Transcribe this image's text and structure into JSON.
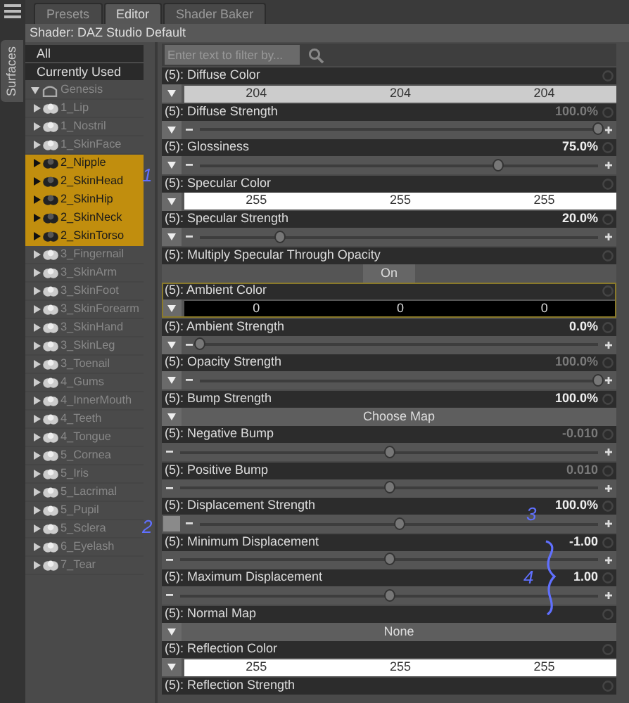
{
  "side_tab": {
    "label": "Surfaces"
  },
  "tabs": [
    {
      "label": "Presets",
      "selected": false
    },
    {
      "label": "Editor",
      "selected": true
    },
    {
      "label": "Shader Baker",
      "selected": false
    }
  ],
  "shader": "Shader: DAZ Studio Default",
  "filters": [
    {
      "label": "All"
    },
    {
      "label": "Currently Used"
    }
  ],
  "tree": {
    "label": "Genesis",
    "expanded": true,
    "children": [
      {
        "label": "1_Lip",
        "selected": false
      },
      {
        "label": "1_Nostril",
        "selected": false
      },
      {
        "label": "1_SkinFace",
        "selected": false
      },
      {
        "label": "2_Nipple",
        "selected": true
      },
      {
        "label": "2_SkinHead",
        "selected": true
      },
      {
        "label": "2_SkinHip",
        "selected": true
      },
      {
        "label": "2_SkinNeck",
        "selected": true
      },
      {
        "label": "2_SkinTorso",
        "selected": true
      },
      {
        "label": "3_Fingernail",
        "selected": false
      },
      {
        "label": "3_SkinArm",
        "selected": false
      },
      {
        "label": "3_SkinFoot",
        "selected": false
      },
      {
        "label": "3_SkinForearm",
        "selected": false
      },
      {
        "label": "3_SkinHand",
        "selected": false
      },
      {
        "label": "3_SkinLeg",
        "selected": false
      },
      {
        "label": "3_Toenail",
        "selected": false
      },
      {
        "label": "4_Gums",
        "selected": false
      },
      {
        "label": "4_InnerMouth",
        "selected": false
      },
      {
        "label": "4_Teeth",
        "selected": false
      },
      {
        "label": "4_Tongue",
        "selected": false
      },
      {
        "label": "5_Cornea",
        "selected": false
      },
      {
        "label": "5_Iris",
        "selected": false
      },
      {
        "label": "5_Lacrimal",
        "selected": false
      },
      {
        "label": "5_Pupil",
        "selected": false
      },
      {
        "label": "5_Sclera",
        "selected": false
      },
      {
        "label": "6_Eyelash",
        "selected": false
      },
      {
        "label": "7_Tear",
        "selected": false
      }
    ]
  },
  "filter_field": {
    "placeholder": "Enter text to filter by..."
  },
  "properties": [
    {
      "kind": "color",
      "label": "(5): Diffuse Color",
      "selected": false,
      "menu": true,
      "color": "#cccccc",
      "values": [
        "204",
        "204",
        "204"
      ]
    },
    {
      "kind": "slider",
      "label": "(5): Diffuse Strength",
      "selected": false,
      "menu": true,
      "value": "100.0%",
      "dimmed": true,
      "level": 1.0
    },
    {
      "kind": "slider",
      "label": "(5): Glossiness",
      "selected": false,
      "menu": true,
      "value": "75.0%",
      "dimmed": false,
      "level": 0.75
    },
    {
      "kind": "color",
      "label": "(5): Specular Color",
      "selected": false,
      "menu": true,
      "color": "#ffffff",
      "values": [
        "255",
        "255",
        "255"
      ]
    },
    {
      "kind": "slider",
      "label": "(5): Specular Strength",
      "selected": false,
      "menu": true,
      "value": "20.0%",
      "dimmed": false,
      "level": 0.2
    },
    {
      "kind": "toggle",
      "label": "(5): Multiply Specular Through Opacity",
      "selected": false,
      "button": "On"
    },
    {
      "kind": "color",
      "label": "(5): Ambient Color",
      "selected": true,
      "menu": true,
      "color": "#000000",
      "values": [
        "0",
        "0",
        "0"
      ]
    },
    {
      "kind": "slider",
      "label": "(5): Ambient Strength",
      "selected": false,
      "menu": true,
      "value": "0.0%",
      "dimmed": false,
      "level": 0.0
    },
    {
      "kind": "slider",
      "label": "(5): Opacity Strength",
      "selected": false,
      "menu": true,
      "value": "100.0%",
      "dimmed": true,
      "level": 1.0
    },
    {
      "kind": "map",
      "label": "(5): Bump Strength",
      "selected": false,
      "menu": true,
      "value": "100.0%",
      "button": "Choose Map"
    },
    {
      "kind": "slider",
      "label": "(5): Negative Bump",
      "selected": false,
      "menu": false,
      "value": "-0.010",
      "dimmed": true,
      "level": 0.5
    },
    {
      "kind": "slider",
      "label": "(5): Positive Bump",
      "selected": false,
      "menu": false,
      "value": "0.010",
      "dimmed": true,
      "level": 0.5
    },
    {
      "kind": "slider",
      "label": "(5): Displacement Strength",
      "selected": false,
      "swatch": true,
      "value": "100.0%",
      "dimmed": false,
      "level": 0.5
    },
    {
      "kind": "slider",
      "label": "(5): Minimum Displacement",
      "selected": false,
      "menu": false,
      "value": "-1.00",
      "dimmed": false,
      "level": 0.5
    },
    {
      "kind": "slider",
      "label": "(5): Maximum Displacement",
      "selected": false,
      "menu": false,
      "value": "1.00",
      "dimmed": false,
      "level": 0.5
    },
    {
      "kind": "map",
      "label": "(5): Normal Map",
      "selected": false,
      "menu": true,
      "button": "None"
    },
    {
      "kind": "color",
      "label": "(5): Reflection Color",
      "selected": false,
      "menu": true,
      "color": "#ffffff",
      "values": [
        "255",
        "255",
        "255"
      ]
    },
    {
      "kind": "title_only",
      "label": "(5): Reflection Strength",
      "selected": false
    }
  ],
  "annotations": [
    {
      "kind": "digit",
      "text": "1"
    },
    {
      "kind": "digit",
      "text": "2"
    },
    {
      "kind": "digit",
      "text": "3"
    },
    {
      "kind": "digit",
      "text": "4"
    },
    {
      "kind": "brace"
    }
  ]
}
